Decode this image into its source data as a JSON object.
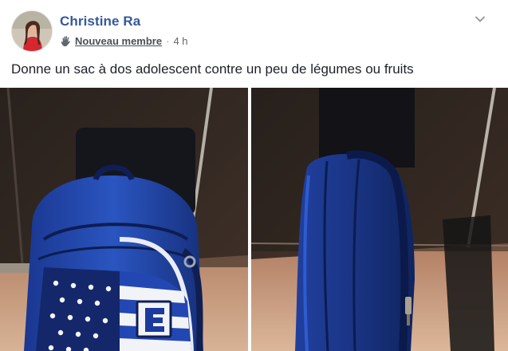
{
  "post": {
    "author": "Christine Ra",
    "badge": "Nouveau membre",
    "separator": "·",
    "time": "4 h",
    "text": "Donne un sac à dos adolescent contre un peu de légumes ou fruits"
  },
  "icons": {
    "badge_icon": "wave-hand-icon",
    "menu_icon": "chevron-down-icon"
  },
  "colors": {
    "author_link": "#365899",
    "meta_text": "#616770",
    "body_text": "#1d2129",
    "backpack_blue": "#1d3f9a"
  }
}
